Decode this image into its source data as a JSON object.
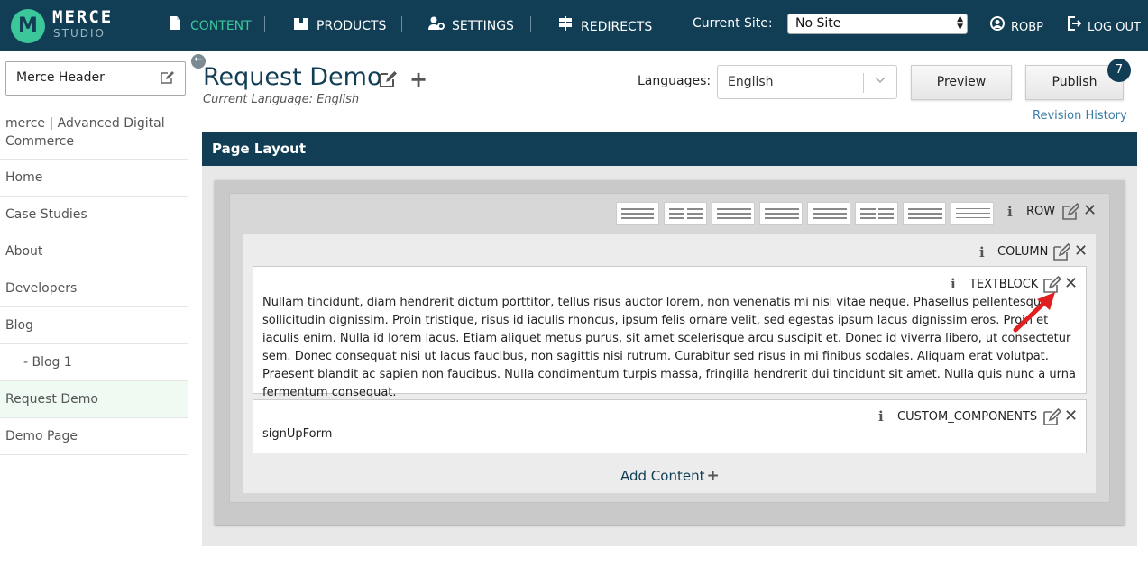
{
  "app": {
    "logo_mark": "M",
    "logo_text": "MERCE",
    "logo_sub": "STUDIO"
  },
  "nav": {
    "items": [
      {
        "label": "CONTENT",
        "icon": "document-icon",
        "active": true
      },
      {
        "label": "PRODUCTS",
        "icon": "box-icon",
        "active": false
      },
      {
        "label": "SETTINGS",
        "icon": "user-gear-icon",
        "active": false
      },
      {
        "label": "REDIRECTS",
        "icon": "signpost-icon",
        "active": false
      }
    ],
    "current_site_label": "Current Site:",
    "current_site_value": "No Site",
    "user": "ROBP",
    "logout": "LOG OUT"
  },
  "sidebar": {
    "header_label": "Merce Header",
    "items": [
      {
        "label": "merce | Advanced Digital Commerce"
      },
      {
        "label": "Home"
      },
      {
        "label": "Case Studies"
      },
      {
        "label": "About"
      },
      {
        "label": "Developers"
      },
      {
        "label": "Blog"
      },
      {
        "label": "- Blog 1"
      },
      {
        "label": "Request Demo"
      },
      {
        "label": "Demo Page"
      }
    ],
    "active_index": 7
  },
  "page": {
    "title": "Request Demo",
    "current_language": "Current Language: English",
    "languages_label": "Languages:",
    "language_value": "English",
    "preview_label": "Preview",
    "publish_label": "Publish",
    "publish_badge": "7",
    "revision_history": "Revision History"
  },
  "layout": {
    "header": "Page Layout",
    "row_label": "ROW",
    "column_label": "COLUMN",
    "textblock_label": "TEXTBLOCK",
    "textblock_content": "Nullam tincidunt, diam hendrerit dictum porttitor, tellus risus auctor lorem, non venenatis mi nisi vitae neque. Phasellus pellentesque sollicitudin dignissim. Proin tristique, risus id iaculis rhoncus, ipsum felis ornare velit, sed egestas ipsum lacus dignissim eros. Proin et iaculis enim. Nulla id lorem lacus. Etiam aliquet metus purus, sit amet scelerisque arcu suscipit et. Donec id viverra libero, ut consectetur sem. Donec consequat nisi ut lacus faucibus, non sagittis nisi rutrum. Curabitur sed risus in mi finibus sodales. Aliquam erat volutpat. Praesent blandit ac sapien non faucibus. Nulla condimentum turpis massa, fringilla hendrerit dui tincidunt sit amet. Nulla quis nunc a urna fermentum consequat.",
    "custom_label": "CUSTOM_COMPONENTS",
    "custom_content": "signUpForm",
    "add_content": "Add Content",
    "column_layouts": [
      1,
      2,
      3,
      4,
      5,
      6,
      7,
      8
    ]
  },
  "colors": {
    "brand_dark": "#113e55",
    "accent_green": "#3cc79b",
    "annotation_arrow": "#e02020"
  }
}
